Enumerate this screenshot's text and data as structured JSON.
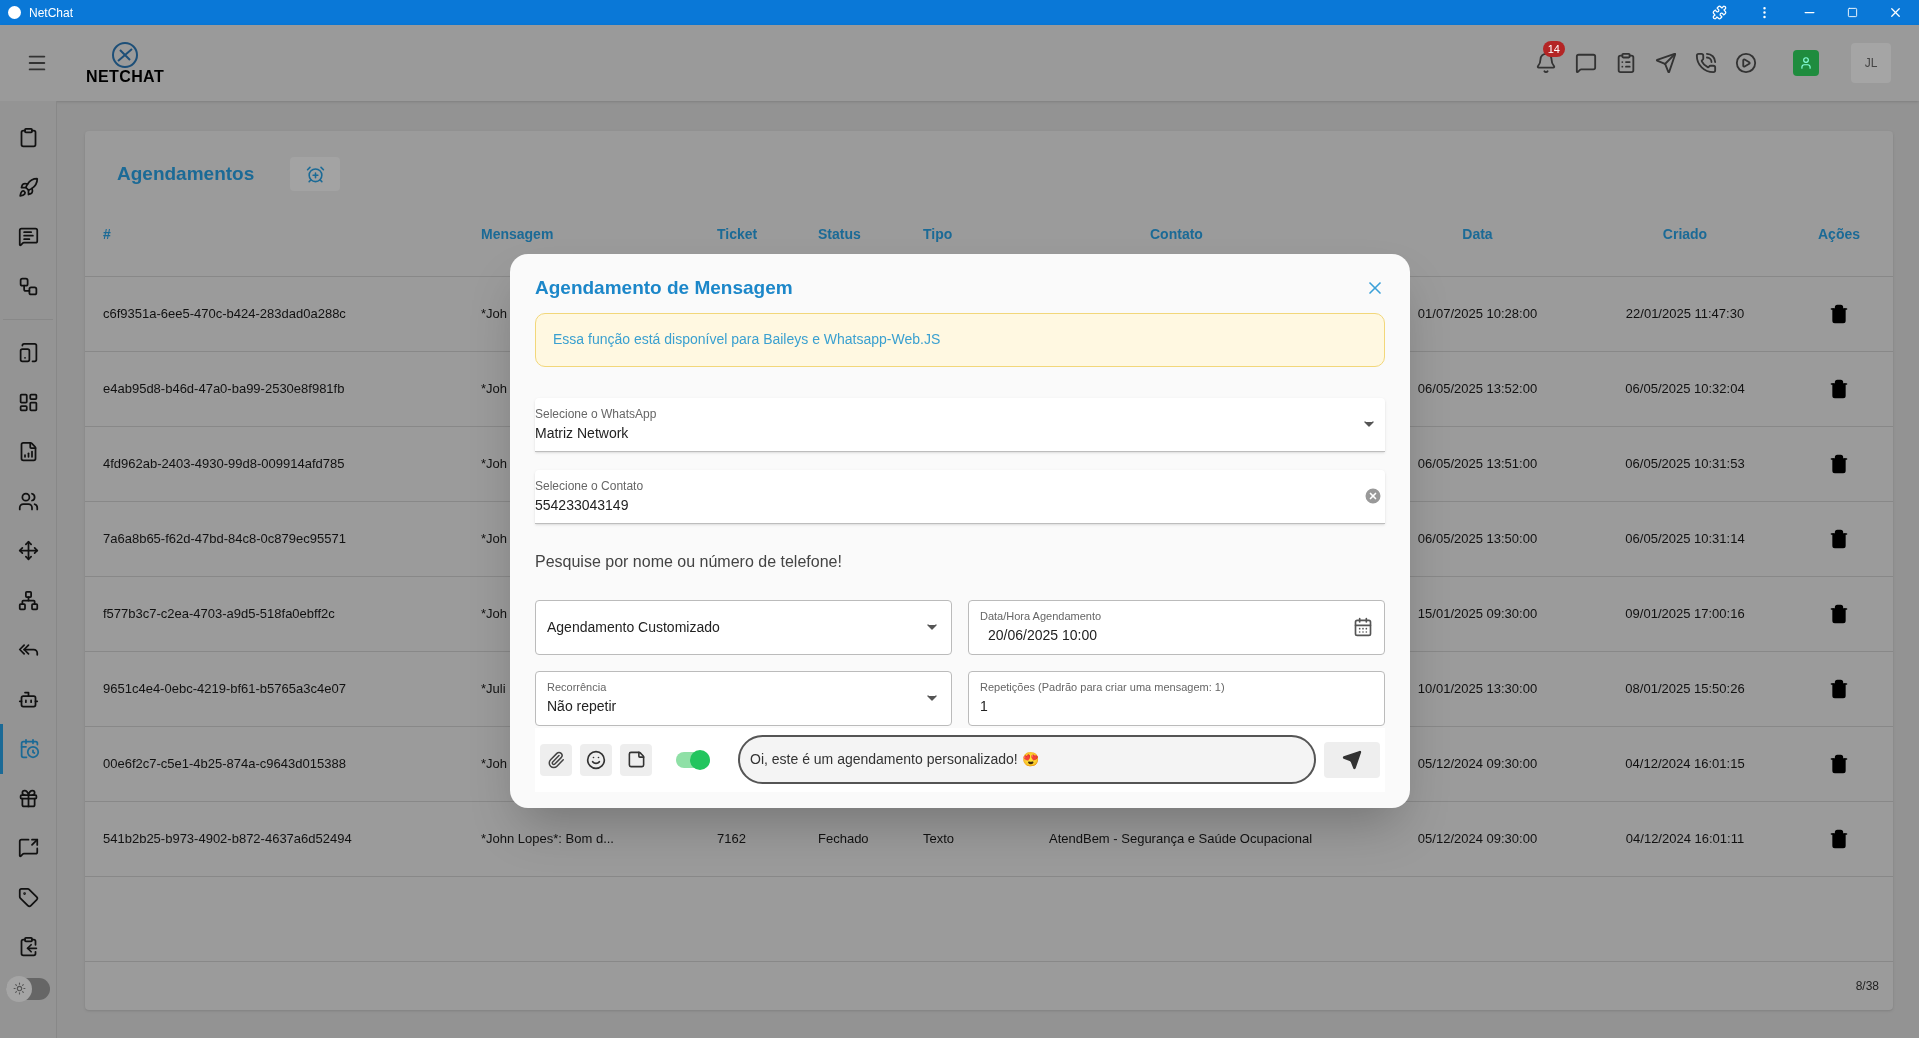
{
  "window": {
    "title": "NetChat"
  },
  "header": {
    "logo": "NETCHAT",
    "notifications": "14",
    "avatar": "JL"
  },
  "sidebar": {
    "items": [
      {
        "selected": false
      },
      {
        "selected": false
      },
      {
        "selected": false
      },
      {
        "selected": false
      },
      {
        "selected": false
      },
      {
        "selected": false
      },
      {
        "selected": false
      },
      {
        "selected": false
      },
      {
        "selected": false
      },
      {
        "selected": false
      },
      {
        "selected": false
      },
      {
        "selected": false
      },
      {
        "selected": true
      },
      {
        "selected": false
      },
      {
        "selected": false
      },
      {
        "selected": false
      },
      {
        "selected": false
      }
    ],
    "theme_toggle": {
      "on": false
    }
  },
  "page": {
    "title": "Agendamentos",
    "columns": [
      "#",
      "Mensagem",
      "Ticket",
      "Status",
      "Tipo",
      "Contato",
      "Data",
      "Criado",
      "Ações"
    ],
    "rows": [
      {
        "id": "c6f9351a-6ee5-470c-b424-283dad0a288c",
        "message": "*Joh",
        "date": "01/07/2025 10:28:00",
        "created": "22/01/2025 11:47:30"
      },
      {
        "id": "e4ab95d8-b46d-47a0-ba99-2530e8f981fb",
        "message": "*Joh",
        "date": "06/05/2025 13:52:00",
        "created": "06/05/2025 10:32:04"
      },
      {
        "id": "4fd962ab-2403-4930-99d8-009914afd785",
        "message": "*Joh",
        "date": "06/05/2025 13:51:00",
        "created": "06/05/2025 10:31:53"
      },
      {
        "id": "7a6a8b65-f62d-47bd-84c8-0c879ec95571",
        "message": "*Joh",
        "date": "06/05/2025 13:50:00",
        "created": "06/05/2025 10:31:14"
      },
      {
        "id": "f577b3c7-c2ea-4703-a9d5-518fa0ebff2c",
        "message": "*Joh",
        "date": "15/01/2025 09:30:00",
        "created": "09/01/2025 17:00:16"
      },
      {
        "id": "9651c4e4-0ebc-4219-bf61-b5765a3c4e07",
        "message": "*Juli",
        "date": "10/01/2025 13:30:00",
        "created": "08/01/2025 15:50:26"
      },
      {
        "id": "00e6f2c7-c5e1-4b25-874a-c9643d015388",
        "message": "*Joh",
        "date": "05/12/2024 09:30:00",
        "created": "04/12/2024 16:01:15"
      },
      {
        "id": "541b2b25-b973-4902-b872-4637a6d52494",
        "message": "*John Lopes*: Bom d...",
        "ticket": "7162",
        "status": "Fechado",
        "type": "Texto",
        "contact": "AtendBem - Segurança e Saúde Ocupacional",
        "date": "05/12/2024 09:30:00",
        "created": "04/12/2024 16:01:11"
      }
    ],
    "pagination": "8/38"
  },
  "modal": {
    "title": "Agendamento de Mensagem",
    "notice": "Essa função está disponível para Baileys e Whatsapp-Web.JS",
    "whatsapp": {
      "label": "Selecione o WhatsApp",
      "value": "Matriz Network"
    },
    "contact": {
      "label": "Selecione o Contato",
      "value": "554233043149"
    },
    "hint": "Pesquise por nome ou número de telefone!",
    "schedule_type": {
      "value": "Agendamento Customizado"
    },
    "datetime": {
      "label": "Data/Hora Agendamento",
      "value": "20/06/2025 10:00"
    },
    "recurrence": {
      "label": "Recorrência",
      "value": "Não repetir"
    },
    "repetitions": {
      "label": "Repetições (Padrão para criar uma mensagem: 1)",
      "value": "1"
    },
    "signature_toggle": {
      "on": true
    },
    "message": {
      "value": "Oi, este é um agendamento personalizado! 😍"
    }
  }
}
